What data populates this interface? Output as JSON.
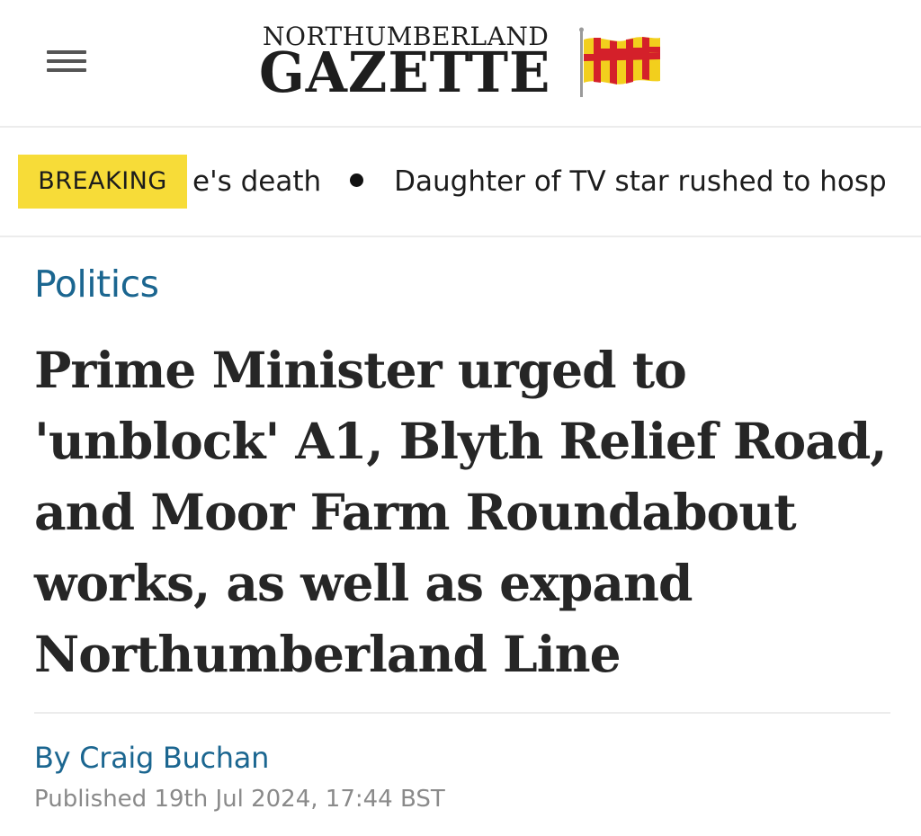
{
  "header": {
    "menu_icon": "hamburger-menu-icon",
    "logo_top": "NORTHUMBERLAND",
    "logo_main": "GAZETTE",
    "flag_icon": "northumberland-flag-icon",
    "flag_colors": [
      "#f2cf1d",
      "#d4202a"
    ]
  },
  "ticker": {
    "badge": "BREAKING",
    "items": [
      "e's death",
      "Daughter of TV star rushed to hosp"
    ],
    "colors": {
      "badge_bg": "#f7dc38"
    }
  },
  "article": {
    "category": "Politics",
    "headline": "Prime Minister urged to 'unblock' A1, Blyth Relief Road, and Moor Farm Roundabout works, as well as expand Northumberland Line",
    "byline_prefix": "By",
    "author": "Craig Buchan",
    "published": "Published 19th Jul 2024, 17:44 BST",
    "colors": {
      "accent": "#1b6690",
      "meta": "#8a8a8a"
    }
  }
}
